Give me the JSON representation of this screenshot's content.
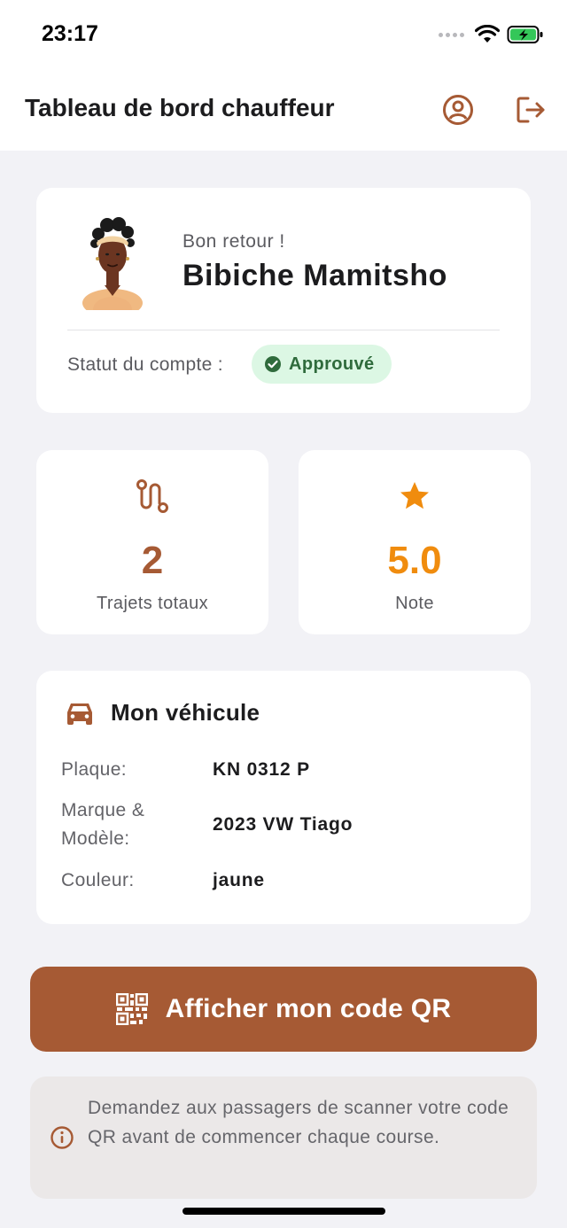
{
  "status_bar": {
    "time": "23:17"
  },
  "app_bar": {
    "title": "Tableau de bord chauffeur"
  },
  "profile": {
    "greeting": "Bon retour !",
    "name": "Bibiche Mamitsho",
    "status_label": "Statut du compte :",
    "status_value": "Approuvé"
  },
  "stats": {
    "trips": {
      "value": "2",
      "label": "Trajets totaux"
    },
    "rating": {
      "value": "5.0",
      "label": "Note"
    }
  },
  "vehicle": {
    "title": "Mon véhicule",
    "rows": [
      {
        "label": "Plaque:",
        "value": "KN 0312 P"
      },
      {
        "label": "Marque & Modèle:",
        "value": "2023 VW Tiago"
      },
      {
        "label": "Couleur:",
        "value": "jaune"
      }
    ]
  },
  "qr_button": {
    "label": "Afficher mon code QR"
  },
  "info": {
    "text": "Demandez aux passagers de scanner votre code QR avant de commencer chaque course."
  },
  "colors": {
    "brand": "#a65a34",
    "accent_orange": "#f08c0e",
    "status_green": "#2f6b3c",
    "status_bg": "#dcf7e4",
    "background": "#f2f2f6"
  },
  "icons": {
    "profile": "user-circle-icon",
    "logout": "logout-icon",
    "trips": "route-icon",
    "rating": "star-icon",
    "vehicle": "car-icon",
    "qr": "qr-code-icon",
    "info": "info-icon",
    "status": "check-circle-icon"
  }
}
